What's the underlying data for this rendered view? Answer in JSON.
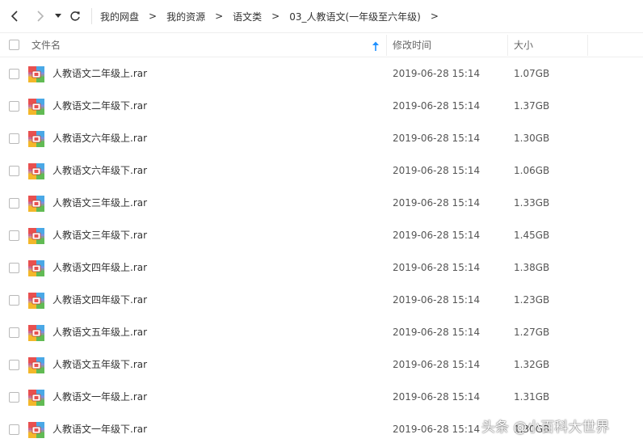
{
  "nav": {
    "back_icon": "chevron-left-icon",
    "forward_icon": "chevron-right-icon",
    "dropdown_icon": "caret-down-icon",
    "refresh_icon": "refresh-icon"
  },
  "breadcrumb": [
    "我的网盘",
    "我的资源",
    "语文类",
    "03_人教语文(一年级至六年级)"
  ],
  "breadcrumb_separator": ">",
  "columns": {
    "name": "文件名",
    "modified": "修改时间",
    "size": "大小"
  },
  "sort": {
    "column": "name",
    "direction": "ascending",
    "color": "#1e90ff"
  },
  "files": [
    {
      "name": "人教语文二年级上.rar",
      "modified": "2019-06-28 15:14",
      "size": "1.07GB"
    },
    {
      "name": "人教语文二年级下.rar",
      "modified": "2019-06-28 15:14",
      "size": "1.37GB"
    },
    {
      "name": "人教语文六年级上.rar",
      "modified": "2019-06-28 15:14",
      "size": "1.30GB"
    },
    {
      "name": "人教语文六年级下.rar",
      "modified": "2019-06-28 15:14",
      "size": "1.06GB"
    },
    {
      "name": "人教语文三年级上.rar",
      "modified": "2019-06-28 15:14",
      "size": "1.33GB"
    },
    {
      "name": "人教语文三年级下.rar",
      "modified": "2019-06-28 15:14",
      "size": "1.45GB"
    },
    {
      "name": "人教语文四年级上.rar",
      "modified": "2019-06-28 15:14",
      "size": "1.38GB"
    },
    {
      "name": "人教语文四年级下.rar",
      "modified": "2019-06-28 15:14",
      "size": "1.23GB"
    },
    {
      "name": "人教语文五年级上.rar",
      "modified": "2019-06-28 15:14",
      "size": "1.27GB"
    },
    {
      "name": "人教语文五年级下.rar",
      "modified": "2019-06-28 15:14",
      "size": "1.32GB"
    },
    {
      "name": "人教语文一年级上.rar",
      "modified": "2019-06-28 15:14",
      "size": "1.31GB"
    },
    {
      "name": "人教语文一年级下.rar",
      "modified": "2019-06-28 15:14",
      "size": "1.30GB"
    }
  ],
  "file_icon": "rar-archive-icon",
  "watermark": "头条 @小百科大世界"
}
